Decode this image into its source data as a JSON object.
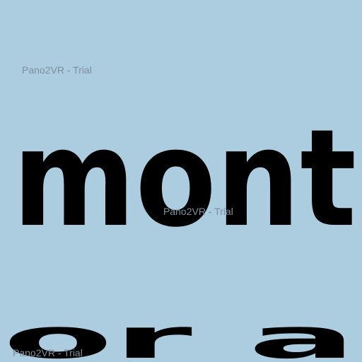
{
  "viewer": {
    "background_color": "#acccdf",
    "ink_color": "#000000",
    "panorama_text_line1": "mont",
    "panorama_text_line2": "or a"
  },
  "watermarks": [
    "Pano2VR - Trial",
    "Pano2VR - Trial",
    "Pano2VR - Trial"
  ]
}
